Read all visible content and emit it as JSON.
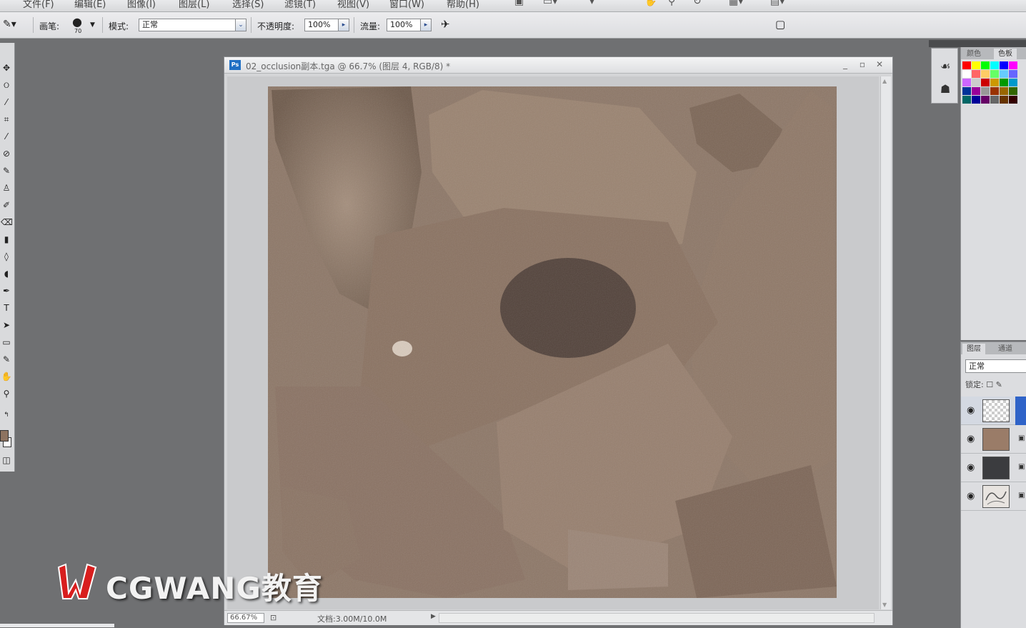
{
  "menubar": {
    "items": [
      "文件(F)",
      "编辑(E)",
      "图像(I)",
      "图层(L)",
      "选择(S)",
      "滤镜(T)",
      "视图(V)",
      "窗口(W)",
      "帮助(H)"
    ],
    "icons": [
      "bridge-icon",
      "screen-mode-icon",
      "zoom-level-icon",
      "hand-tool-icon",
      "zoom-tool-icon",
      "rotate-icon",
      "arrange-icon",
      "workspace-icon"
    ]
  },
  "options": {
    "brush_label": "画笔:",
    "brush_size": "70",
    "mode_label": "模式:",
    "mode_value": "正常",
    "opacity_label": "不透明度:",
    "opacity_value": "100%",
    "flow_label": "流量:",
    "flow_value": "100%"
  },
  "document": {
    "title": "02_occlusion副本.tga @ 66.7% (图层 4, RGB/8) *",
    "ps_badge": "Ps",
    "zoom_field": "66.67%",
    "doc_info": "文档:3.00M/10.0M"
  },
  "watermark": {
    "text": "CGWANG教育",
    "logo_letter": "W"
  },
  "swatches_panel": {
    "tabs": [
      "颜色",
      "色板"
    ],
    "colors": [
      "#ff0000",
      "#ffff00",
      "#00ff00",
      "#00ffff",
      "#0000ff",
      "#ff00ff",
      "#ffffff",
      "#ff6666",
      "#ffcc66",
      "#66ff66",
      "#66ccff",
      "#6666ff",
      "#cc66ff",
      "#cccccc",
      "#cc0000",
      "#cc9900",
      "#009900",
      "#0099cc",
      "#003399",
      "#990099",
      "#999999",
      "#993300",
      "#996600",
      "#336600",
      "#006666",
      "#000099",
      "#660066",
      "#666666",
      "#663300",
      "#330000"
    ]
  },
  "layers_panel": {
    "tabs": [
      "图层",
      "通道"
    ],
    "blend_mode": "正常",
    "lock_label": "锁定:",
    "layers": [
      {
        "thumb": "transparent",
        "selected": true
      },
      {
        "thumb": "#9a7c68",
        "selected": false
      },
      {
        "thumb": "#3b3c3f",
        "selected": false
      },
      {
        "thumb": "texture",
        "selected": false
      }
    ]
  }
}
